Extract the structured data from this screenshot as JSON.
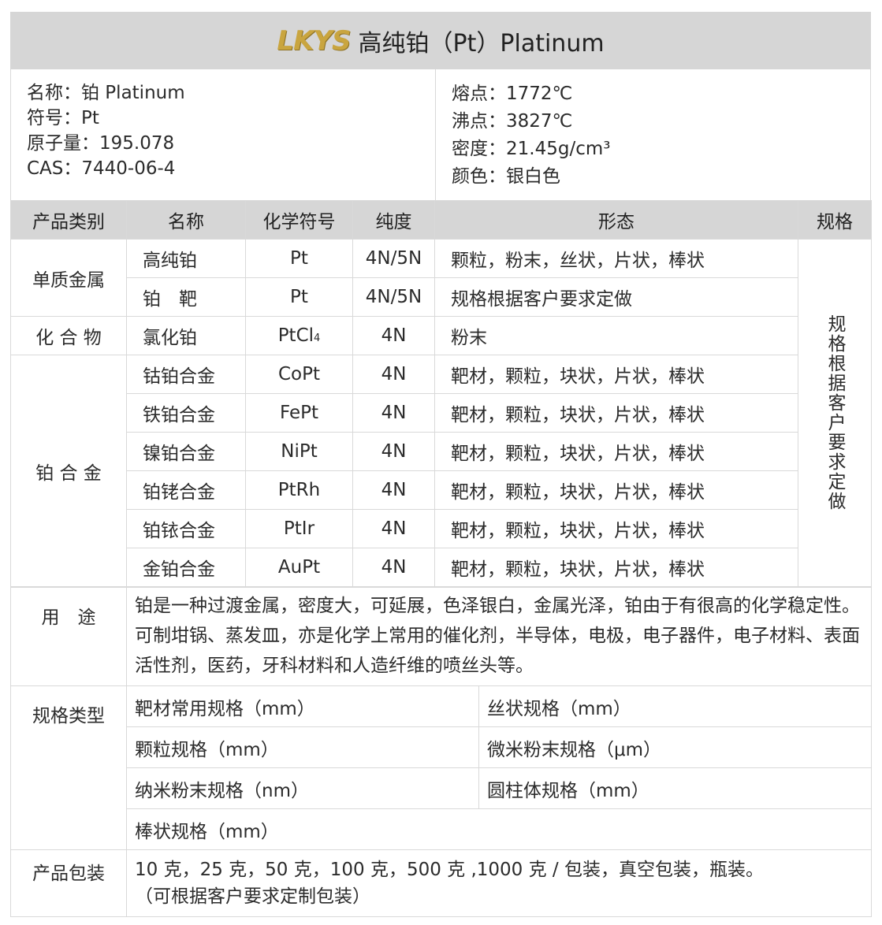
{
  "header": {
    "logo": "LKYS",
    "title": "高纯铂（Pt）Platinum"
  },
  "properties": {
    "left": [
      "名称：铂 Platinum",
      "符号：Pt",
      "原子量：195.078",
      "CAS：7440-06-4"
    ],
    "right": [
      "熔点：1772℃",
      "沸点：3827℃",
      "密度：21.45g/cm³",
      "颜色：银白色"
    ]
  },
  "table_headers": [
    "产品类别",
    "名称",
    "化学符号",
    "纯度",
    "形态",
    "规格"
  ],
  "groups": [
    "单质金属",
    "化 合 物",
    "铂 合 金"
  ],
  "rows": [
    {
      "name": "高纯铂",
      "symbol": "Pt",
      "purity": "4N/5N",
      "form": "颗粒，粉末，丝状，片状，棒状"
    },
    {
      "name": "铂　靶",
      "symbol": "Pt",
      "purity": "4N/5N",
      "form": "规格根据客户要求定做"
    },
    {
      "name": "氯化铂",
      "symbol": "PtCl",
      "symbol_sub": "4",
      "purity": "4N",
      "form": "粉末"
    },
    {
      "name": "钴铂合金",
      "symbol": "CoPt",
      "purity": "4N",
      "form": "靶材，颗粒，块状，片状，棒状"
    },
    {
      "name": "铁铂合金",
      "symbol": "FePt",
      "purity": "4N",
      "form": "靶材，颗粒，块状，片状，棒状"
    },
    {
      "name": "镍铂合金",
      "symbol": "NiPt",
      "purity": "4N",
      "form": "靶材，颗粒，块状，片状，棒状"
    },
    {
      "name": "铂铑合金",
      "symbol": "PtRh",
      "purity": "4N",
      "form": "靶材，颗粒，块状，片状，棒状"
    },
    {
      "name": "铂铱合金",
      "symbol": "PtIr",
      "purity": "4N",
      "form": "靶材，颗粒，块状，片状，棒状"
    },
    {
      "name": "金铂合金",
      "symbol": "AuPt",
      "purity": "4N",
      "form": "靶材，颗粒，块状，片状，棒状"
    }
  ],
  "spec_note": "规格根据客户要求定做",
  "usage": {
    "label": "用　途",
    "text": "铂是一种过渡金属，密度大，可延展，色泽银白，金属光泽，铂由于有很高的化学稳定性。可制坩锅、蒸发皿，亦是化学上常用的催化剂，半导体，电极，电子器件，电子材料、表面活性剂，医药，牙科材料和人造纤维的喷丝头等。"
  },
  "spec_types": {
    "label": "规格类型",
    "items": [
      "靶材常用规格（mm）",
      "丝状规格（mm）",
      "颗粒规格（mm）",
      "微米粉末规格（μm）",
      "纳米粉末规格（nm）",
      "圆柱体规格（mm）",
      "棒状规格（mm）"
    ]
  },
  "packaging": {
    "label": "产品包装",
    "line1": "10 克，25 克，50 克，100 克，500 克 ,1000 克 / 包装，真空包装，瓶装。",
    "line2": "（可根据客户要求定制包装）"
  }
}
